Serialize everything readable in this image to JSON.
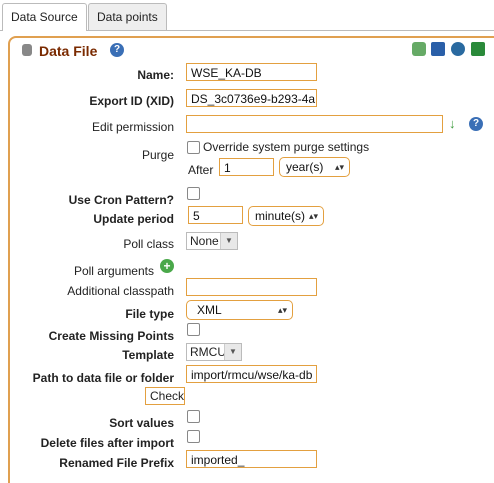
{
  "tabs": {
    "data_source": "Data Source",
    "data_points": "Data points"
  },
  "section_title": "Data File",
  "icons": {
    "help": "?",
    "save": "save-icon",
    "db": "database-icon",
    "export": "export-icon",
    "csv": "csv-icon"
  },
  "fields": {
    "name_label": "Name:",
    "name_value": "WSE_KA-DB",
    "xid_label": "Export ID (XID)",
    "xid_value": "DS_3c0736e9-b293-4a",
    "edit_permission_label": "Edit permission",
    "edit_permission_value": "",
    "purge_label": "Purge",
    "purge_override_label": "Override system purge settings",
    "purge_after_label": "After",
    "purge_after_value": "1",
    "purge_unit": "year(s)",
    "cron_label": "Use Cron Pattern?",
    "update_period_label": "Update period",
    "update_period_value": "5",
    "update_period_unit": "minute(s)",
    "poll_class_label": "Poll class",
    "poll_class_value": "None",
    "poll_arguments_label": "Poll arguments",
    "classpath_label": "Additional classpath",
    "classpath_value": "",
    "file_type_label": "File type",
    "file_type_value": "XML",
    "create_missing_label": "Create Missing Points",
    "template_label": "Template",
    "template_value": "RMCU",
    "path_label": "Path to data file or folder",
    "path_value": "import/rmcu/wse/ka-db",
    "check_button": "Check",
    "sort_values_label": "Sort values",
    "delete_files_label": "Delete files after import",
    "renamed_prefix_label": "Renamed File Prefix",
    "renamed_prefix_value": "imported_"
  }
}
